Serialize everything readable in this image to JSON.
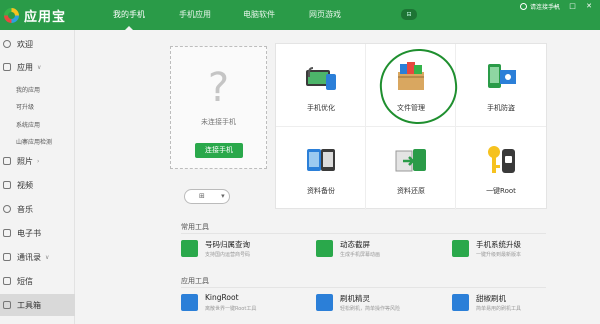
{
  "app": {
    "name": "应用宝"
  },
  "topnav": {
    "tabs": [
      {
        "label": "我的手机"
      },
      {
        "label": "手机应用"
      },
      {
        "label": "电脑软件"
      },
      {
        "label": "网页游戏"
      }
    ],
    "badge": "⊟",
    "login": "请连接手机",
    "window_controls": "— □ ✕"
  },
  "sidebar": {
    "items": [
      {
        "label": "欢迎"
      },
      {
        "label": "应用",
        "arrow": "∨"
      },
      {
        "label": "照片",
        "arrow": "›"
      },
      {
        "label": "视频"
      },
      {
        "label": "音乐"
      },
      {
        "label": "电子书"
      },
      {
        "label": "通讯录",
        "arrow": "∨"
      },
      {
        "label": "短信"
      },
      {
        "label": "工具箱"
      }
    ],
    "subitems": [
      "我的应用",
      "可升级",
      "系统应用",
      "山寨应用检测"
    ]
  },
  "device": {
    "placeholder": "?",
    "status": "未连接手机",
    "connect_button": "连接手机",
    "select_icon": "⊞",
    "select_arrow": "▾"
  },
  "tools": [
    {
      "label": "手机优化",
      "icon": "phone-optimize-icon"
    },
    {
      "label": "文件管理",
      "icon": "file-manager-icon"
    },
    {
      "label": "手机防盗",
      "icon": "anti-theft-icon"
    },
    {
      "label": "资料备份",
      "icon": "backup-icon"
    },
    {
      "label": "资料还原",
      "icon": "restore-icon"
    },
    {
      "label": "一键Root",
      "icon": "root-key-icon"
    }
  ],
  "common_tools": {
    "title": "常用工具",
    "items": [
      {
        "name": "号码归属查询",
        "desc": "支持国内运营商号码",
        "color": "#2aa84b"
      },
      {
        "name": "动态截屏",
        "desc": "生成手机屏幕动画",
        "color": "#2aa84b"
      },
      {
        "name": "手机系统升级",
        "desc": "一键升级到最新版本",
        "color": "#2aa84b"
      }
    ]
  },
  "app_tools": {
    "title": "应用工具",
    "items": [
      {
        "name": "KingRoot",
        "desc": "离散世界一键Root工具",
        "color": "#2b7fd8"
      },
      {
        "name": "刷机精灵",
        "desc": "轻松刷机，简单操作等风险",
        "color": "#2b7fd8"
      },
      {
        "name": "甜椒刷机",
        "desc": "简单易用的刷机工具",
        "color": "#2b7fd8"
      }
    ]
  },
  "colors": {
    "brand_green": "#2a9b48",
    "accent_blue": "#2b7fd8"
  }
}
